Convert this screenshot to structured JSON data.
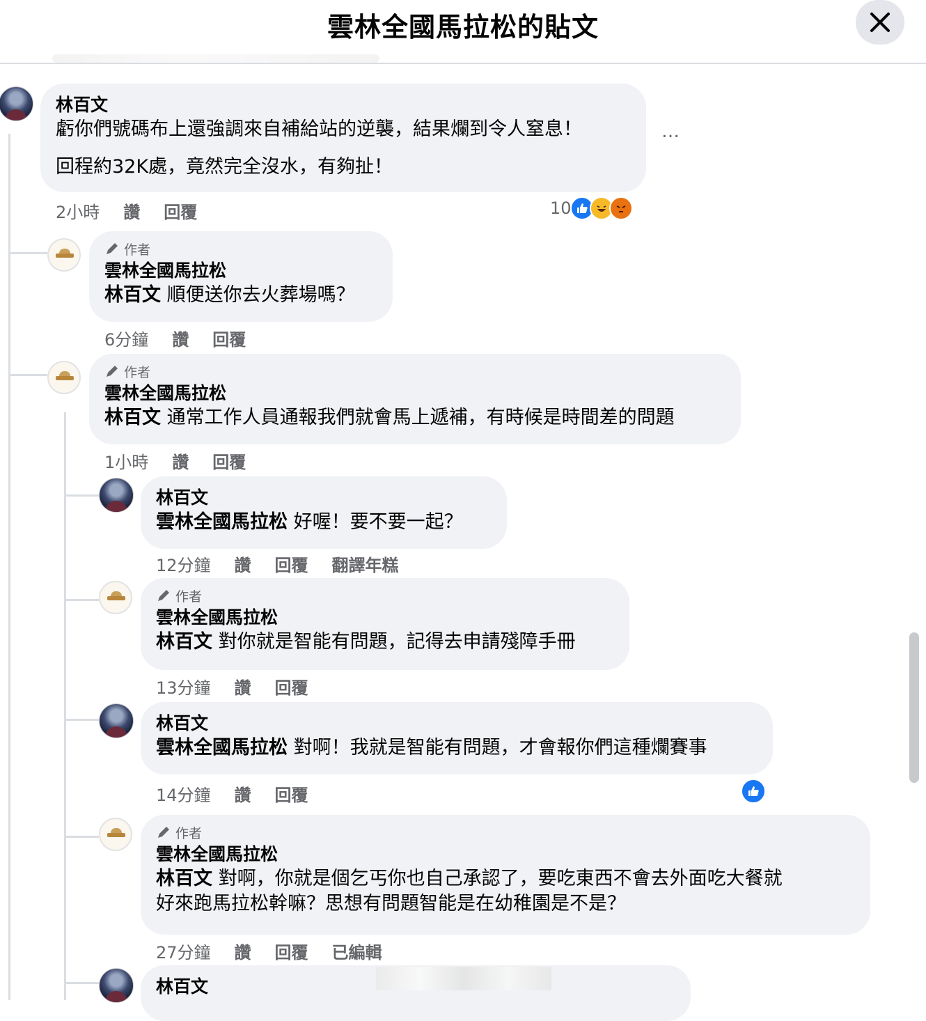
{
  "header": {
    "title": "雲林全國馬拉松的貼文"
  },
  "colors": {
    "like_blue": "#1877f2",
    "haha_yellow": "#f7b928",
    "angry_orange": "#e9710f"
  },
  "icons": {
    "close": "close-icon",
    "author": "pencil-icon",
    "like": "like-icon",
    "haha": "haha-icon",
    "angry": "angry-icon",
    "more": "more-options-icon"
  },
  "comments": [
    {
      "name": "林百文",
      "line1": "虧你們號碼布上還強調來自補給站的逆襲，結果爛到令人窒息！",
      "line2": "回程約32K處，竟然完全沒水，有夠扯！",
      "time": "2小時",
      "like": "讚",
      "reply": "回覆",
      "more": "…",
      "reaction_count": "10"
    },
    {
      "badge": "作者",
      "name": "雲林全國馬拉松",
      "mention": "林百文",
      "text": " 順便送你去火葬場嗎？",
      "time": "6分鐘",
      "like": "讚",
      "reply": "回覆"
    },
    {
      "badge": "作者",
      "name": "雲林全國馬拉松",
      "mention": "林百文",
      "text": " 通常工作人員通報我們就會馬上遞補，有時候是時間差的問題",
      "time": "1小時",
      "like": "讚",
      "reply": "回覆"
    },
    {
      "name": "林百文",
      "mention": "雲林全國馬拉松",
      "text": " 好喔！要不要一起？",
      "time": "12分鐘",
      "like": "讚",
      "reply": "回覆",
      "translate": "翻譯年糕"
    },
    {
      "badge": "作者",
      "name": "雲林全國馬拉松",
      "mention": "林百文",
      "text": " 對你就是智能有問題，記得去申請殘障手冊",
      "time": "13分鐘",
      "like": "讚",
      "reply": "回覆"
    },
    {
      "name": "林百文",
      "mention": "雲林全國馬拉松",
      "text": " 對啊！我就是智能有問題，才會報你們這種爛賽事",
      "time": "14分鐘",
      "like": "讚",
      "reply": "回覆"
    },
    {
      "badge": "作者",
      "name": "雲林全國馬拉松",
      "mention": "林百文",
      "text": " 對啊，你就是個乞丐你也自己承認了，要吃東西不會去外面吃大餐就",
      "text2": "好來跑馬拉松幹嘛？思想有問題智能是在幼稚園是不是？",
      "time": "27分鐘",
      "like": "讚",
      "reply": "回覆",
      "edited": "已編輯"
    },
    {
      "name": "林百文"
    }
  ]
}
